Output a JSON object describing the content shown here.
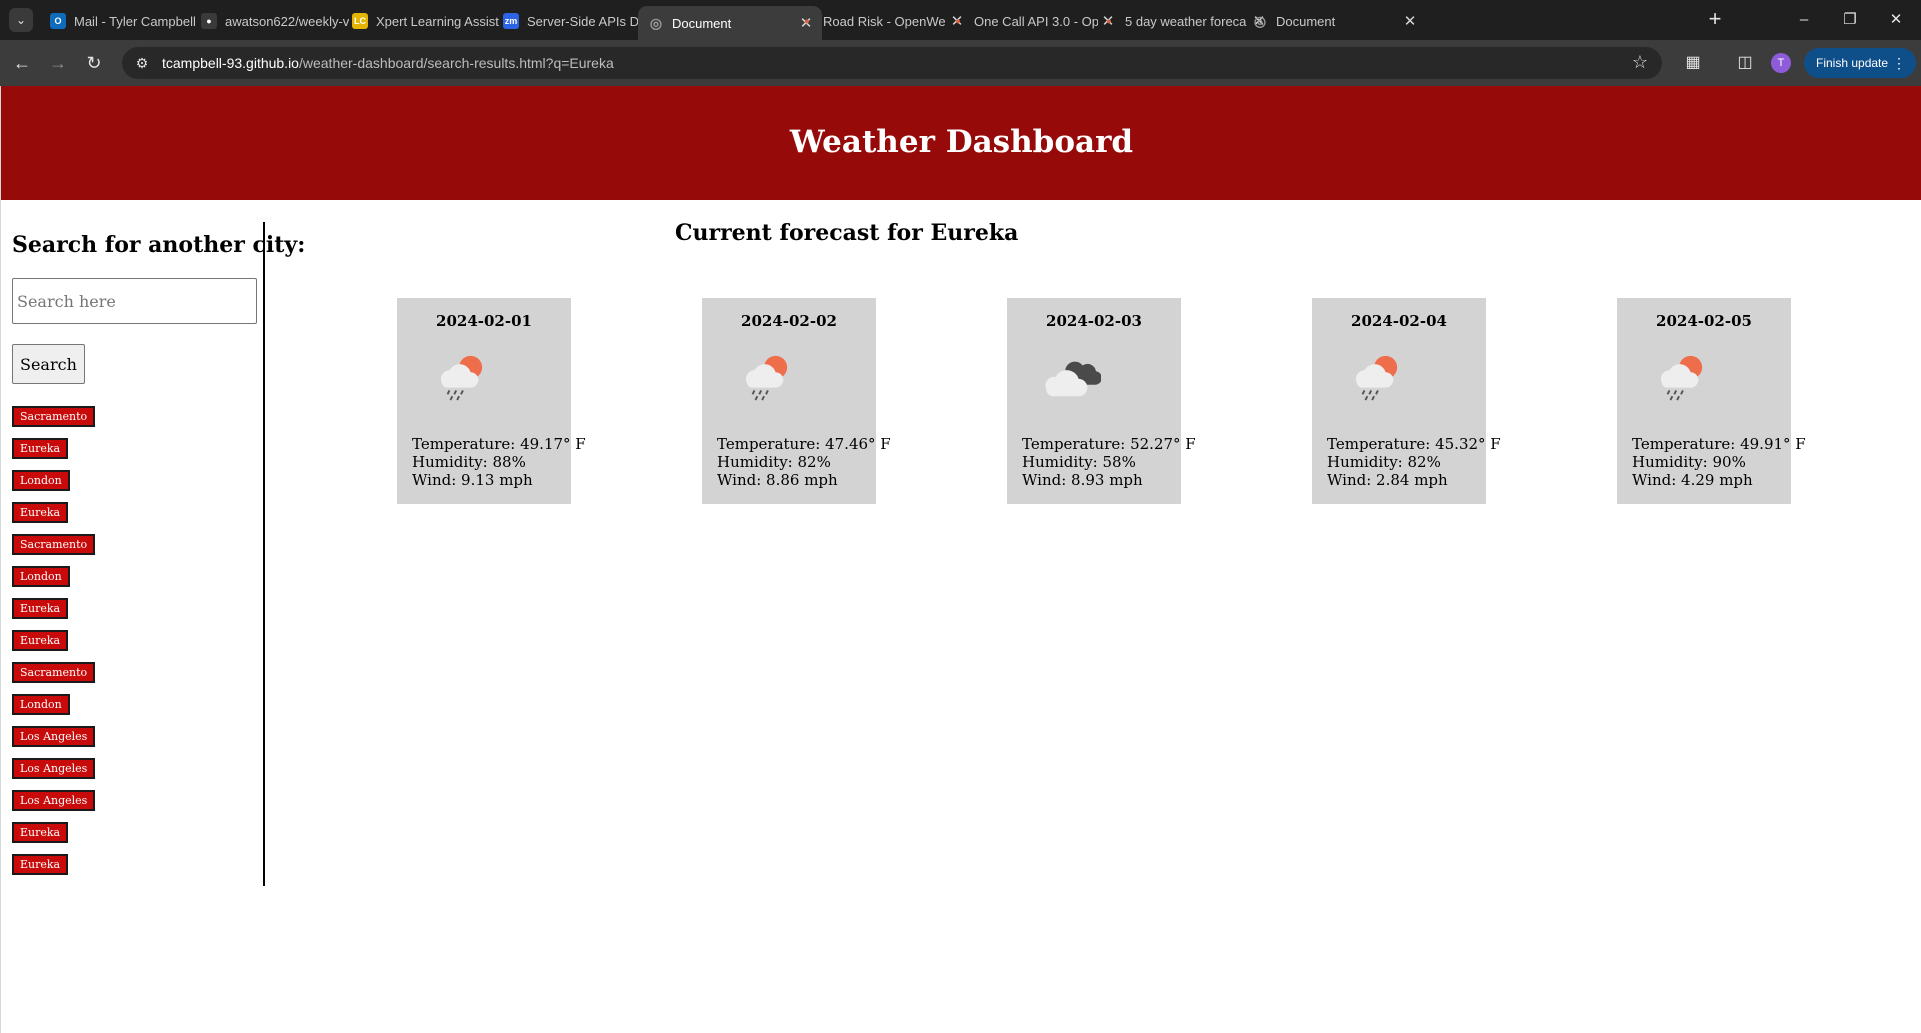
{
  "browser": {
    "tabs": [
      {
        "title": "Mail - Tyler Campbell",
        "favicon": "outlook-icon",
        "color": "#0f6cbd"
      },
      {
        "title": "awatson622/weekly-v",
        "favicon": "github-icon",
        "color": "#3a3a3a"
      },
      {
        "title": "Xpert Learning Assist",
        "favicon": "xpert-icon",
        "color": "#e5b400"
      },
      {
        "title": "Server-Side APIs Day",
        "favicon": "zoom-icon",
        "color": "#2d64e6"
      },
      {
        "title": "Document",
        "favicon": "globe-icon",
        "color": "#6b6b6b",
        "active": true
      },
      {
        "title": "Road Risk - OpenWe",
        "favicon": "openweather-icon",
        "color": "#e0603f"
      },
      {
        "title": "One Call API 3.0 - Op",
        "favicon": "openweather-icon",
        "color": "#e0603f"
      },
      {
        "title": "5 day weather foreca",
        "favicon": "openweather-icon",
        "color": "#e0603f"
      },
      {
        "title": "Document",
        "favicon": "globe-icon",
        "color": "#6b6b6b"
      }
    ],
    "url_host": "tcampbell-93.github.io",
    "url_path": "/weather-dashboard/search-results.html?q=Eureka",
    "profile_initial": "T",
    "finish_update_label": "Finish update"
  },
  "header": {
    "title": "Weather Dashboard",
    "background": "#960a0a"
  },
  "sidebar": {
    "heading": "Search for another city:",
    "search_placeholder": "Search here",
    "search_button": "Search",
    "history": [
      "Sacramento",
      "Eureka",
      "London",
      "Eureka",
      "Sacramento",
      "London",
      "Eureka",
      "Eureka",
      "Sacramento",
      "London",
      "Los Angeles",
      "Los Angeles",
      "Los Angeles",
      "Eureka",
      "Eureka"
    ],
    "history_color": "#c90a0a"
  },
  "main": {
    "title": "Current forecast for Eureka",
    "forecast": [
      {
        "date": "2024-02-01",
        "icon": "rain-sun-cloud-icon",
        "temperature": "Temperature: 49.17° F",
        "humidity": "Humidity: 88%",
        "wind": "Wind: 9.13 mph"
      },
      {
        "date": "2024-02-02",
        "icon": "rain-sun-cloud-icon",
        "temperature": "Temperature: 47.46° F",
        "humidity": "Humidity: 82%",
        "wind": "Wind: 8.86 mph"
      },
      {
        "date": "2024-02-03",
        "icon": "broken-clouds-icon",
        "temperature": "Temperature: 52.27° F",
        "humidity": "Humidity: 58%",
        "wind": "Wind: 8.93 mph"
      },
      {
        "date": "2024-02-04",
        "icon": "rain-sun-cloud-icon",
        "temperature": "Temperature: 45.32° F",
        "humidity": "Humidity: 82%",
        "wind": "Wind: 2.84 mph"
      },
      {
        "date": "2024-02-05",
        "icon": "rain-sun-cloud-icon",
        "temperature": "Temperature: 49.91° F",
        "humidity": "Humidity: 90%",
        "wind": "Wind: 4.29 mph"
      }
    ]
  }
}
